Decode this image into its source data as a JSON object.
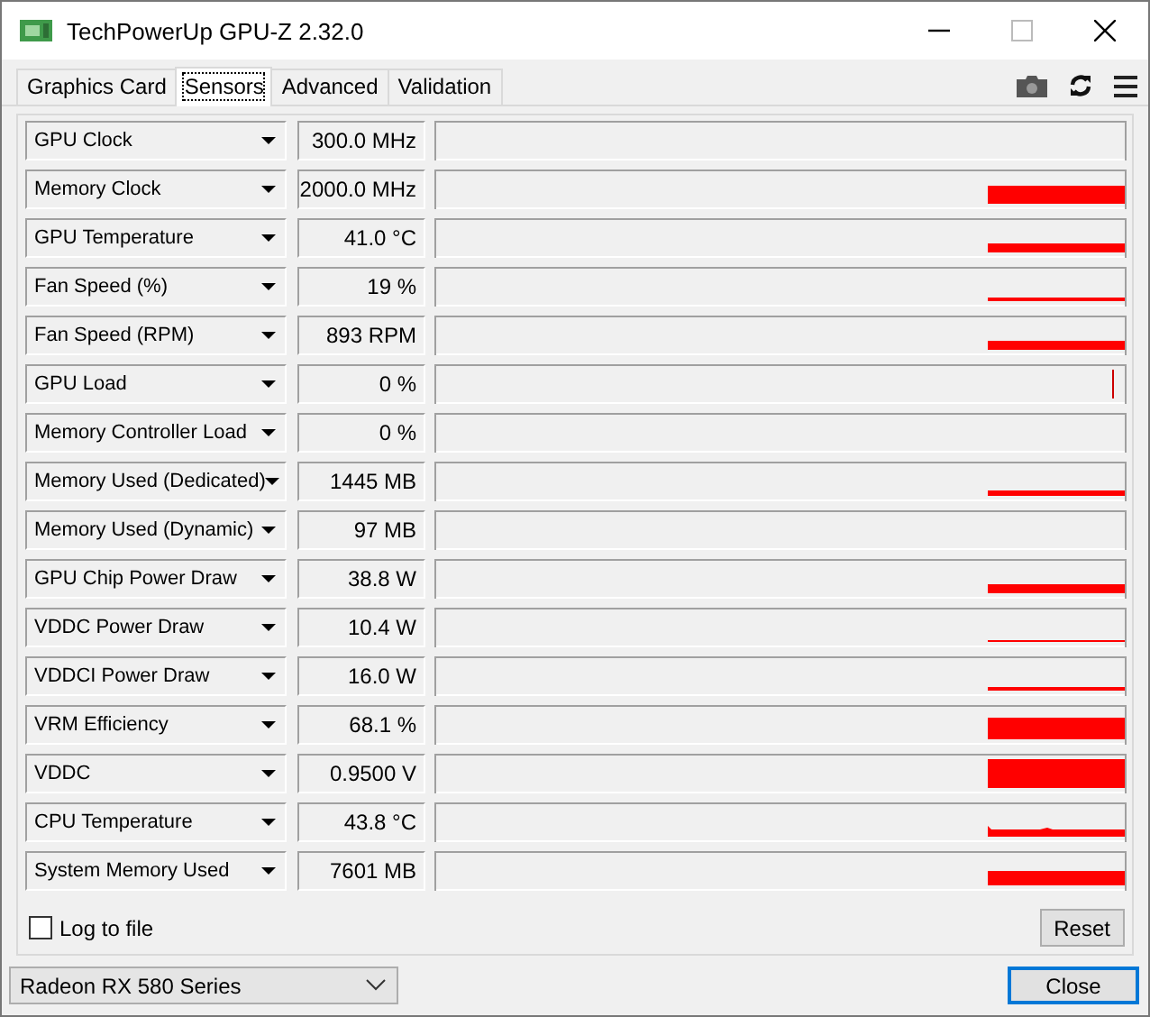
{
  "window": {
    "title": "TechPowerUp GPU-Z 2.32.0"
  },
  "tabs": [
    {
      "label": "Graphics Card",
      "selected": false
    },
    {
      "label": "Sensors",
      "selected": true
    },
    {
      "label": "Advanced",
      "selected": false
    },
    {
      "label": "Validation",
      "selected": false
    }
  ],
  "sensors": [
    {
      "name": "GPU Clock",
      "value": "300.0 MHz"
    },
    {
      "name": "Memory Clock",
      "value": "2000.0 MHz"
    },
    {
      "name": "GPU Temperature",
      "value": "41.0 °C"
    },
    {
      "name": "Fan Speed (%)",
      "value": "19 %"
    },
    {
      "name": "Fan Speed (RPM)",
      "value": "893 RPM"
    },
    {
      "name": "GPU Load",
      "value": "0 %"
    },
    {
      "name": "Memory Controller Load",
      "value": "0 %"
    },
    {
      "name": "Memory Used (Dedicated)",
      "value": "1445 MB"
    },
    {
      "name": "Memory Used (Dynamic)",
      "value": "97 MB"
    },
    {
      "name": "GPU Chip Power Draw",
      "value": "38.8 W"
    },
    {
      "name": "VDDC Power Draw",
      "value": "10.4 W"
    },
    {
      "name": "VDDCI Power Draw",
      "value": "16.0 W"
    },
    {
      "name": "VRM Efficiency",
      "value": "68.1 %"
    },
    {
      "name": "VDDC",
      "value": "0.9500 V"
    },
    {
      "name": "CPU Temperature",
      "value": "43.8 °C"
    },
    {
      "name": "System Memory Used",
      "value": "7601 MB"
    }
  ],
  "log_to_file": {
    "label": "Log to file",
    "checked": false
  },
  "reset_button": "Reset",
  "device_select": {
    "value": "Radeon RX 580 Series"
  },
  "close_button": "Close"
}
